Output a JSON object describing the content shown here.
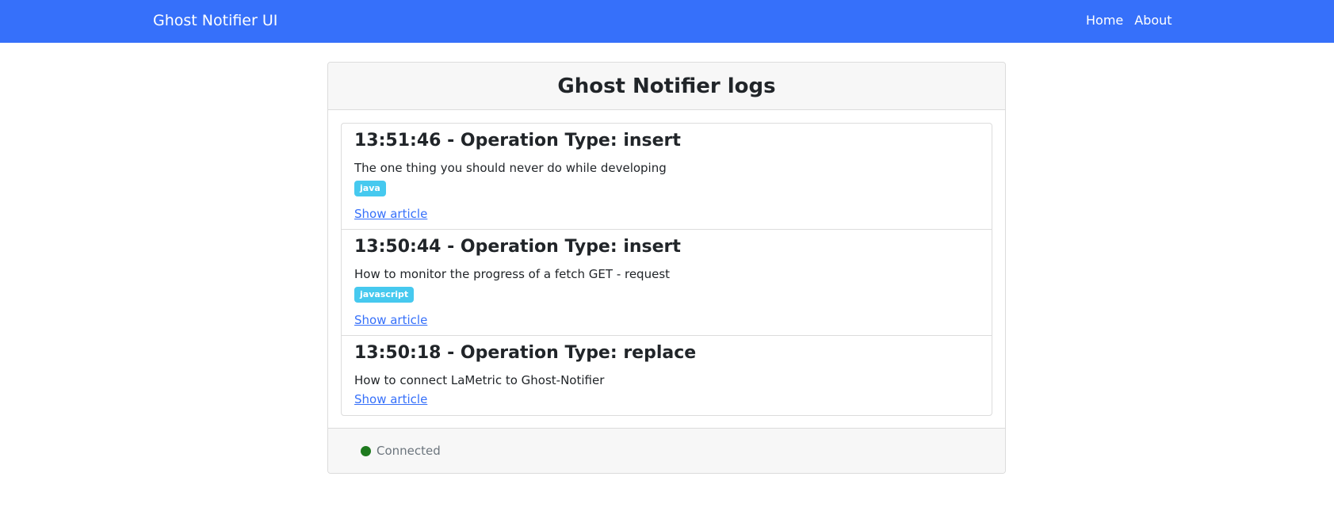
{
  "app": {
    "brand": "Ghost Notifier UI",
    "nav": {
      "home": "Home",
      "about": "About"
    }
  },
  "card": {
    "title": "Ghost Notifier logs"
  },
  "logs": [
    {
      "title": "13:51:46 - Operation Type: insert",
      "description": "The one thing you should never do while developing",
      "tag": "java",
      "link_label": "Show article"
    },
    {
      "title": "13:50:44 - Operation Type: insert",
      "description": "How to monitor the progress of a fetch GET - request",
      "tag": "javascript",
      "link_label": "Show article"
    },
    {
      "title": "13:50:18 - Operation Type: replace",
      "description": "How to connect LaMetric to Ghost-Notifier",
      "tag": "",
      "link_label": "Show article"
    }
  ],
  "status": {
    "label": "Connected",
    "color": "#1e7a1e"
  },
  "colors": {
    "navbar": "#3670fa",
    "badge": "#46c9ef",
    "link": "#3670fa"
  }
}
